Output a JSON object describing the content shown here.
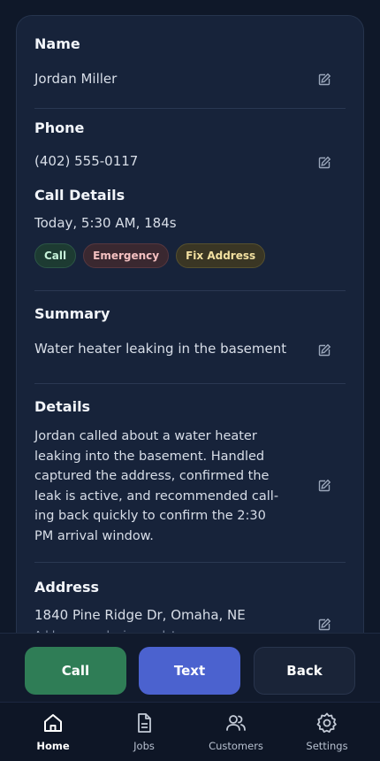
{
  "contact": {
    "name_label": "Name",
    "name_value": "Jordan Miller",
    "phone_label": "Phone",
    "phone_value": "(402) 555-0117"
  },
  "call_details": {
    "label": "Call Details",
    "value": "Today, 5:30 AM, 184s",
    "tags": [
      "Call",
      "Emergency",
      "Fix Address"
    ]
  },
  "summary": {
    "label": "Summary",
    "value": "Water heater leaking in the basement"
  },
  "details": {
    "label": "Details",
    "value": "Jordan called about a water heater leaking into the basement. Handled captured the address, confirmed the leak is active, and recommended call-ing back quickly to confirm the 2:30 PM arrival window."
  },
  "address": {
    "label": "Address",
    "value": "1840 Pine Ridge Dr, Omaha, NE",
    "note": "Address may be incomplete"
  },
  "actions": {
    "call": "Call",
    "text": "Text",
    "back": "Back"
  },
  "nav": {
    "home": "Home",
    "jobs": "Jobs",
    "customers": "Customers",
    "settings": "Settings"
  }
}
